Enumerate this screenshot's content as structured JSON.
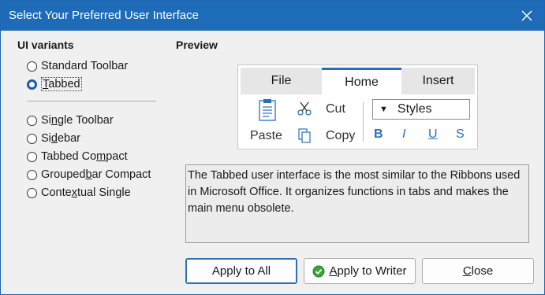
{
  "window": {
    "title": "Select Your Preferred User Interface",
    "accent_color": "#1e6bb8"
  },
  "variants": {
    "heading": "UI variants",
    "options": [
      {
        "pre": "",
        "key": "",
        "post": "Standard Toolbar",
        "selected": false
      },
      {
        "pre": "",
        "key": "T",
        "post": "abbed",
        "selected": true
      },
      {
        "pre": "Si",
        "key": "n",
        "post": "gle Toolbar",
        "selected": false
      },
      {
        "pre": "Si",
        "key": "d",
        "post": "ebar",
        "selected": false
      },
      {
        "pre": "Tabbed Co",
        "key": "m",
        "post": "pact",
        "selected": false
      },
      {
        "pre": "Grouped",
        "key": "b",
        "post": "ar Compact",
        "selected": false
      },
      {
        "pre": "Conte",
        "key": "x",
        "post": "tual Single",
        "selected": false
      }
    ]
  },
  "preview": {
    "heading": "Preview",
    "tabs": [
      "File",
      "Home",
      "Insert"
    ],
    "active_tab": "Home",
    "paste_label": "Paste",
    "cut_label": "Cut",
    "copy_label": "Copy",
    "styles_label": "Styles",
    "bold": "B",
    "italic": "I",
    "underline": "U",
    "strike": "S"
  },
  "description": "The Tabbed user interface is the most similar to the Ribbons used in Microsoft Office. It organizes functions in tabs and makes the main menu obsolete.",
  "buttons": {
    "apply_all": "Apply to All",
    "apply_writer_key": "A",
    "apply_writer_rest": "pply to Writer",
    "close_key": "C",
    "close_rest": "lose"
  }
}
